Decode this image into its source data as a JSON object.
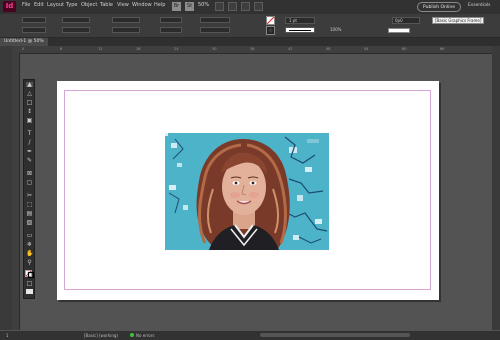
{
  "app": {
    "logo": "Id"
  },
  "menu": [
    "File",
    "Edit",
    "Layout",
    "Type",
    "Object",
    "Table",
    "View",
    "Window",
    "Help"
  ],
  "toolbar_icons": {
    "bridge": "Br",
    "stock": "St"
  },
  "zoom": "50%",
  "publish_label": "Publish Online",
  "workspace_label": "Essentials",
  "control": {
    "stroke_weight": "1 pt",
    "opacity": "100%",
    "frame_style": "[Basic Graphics Frame]",
    "ref_value": "0p0"
  },
  "document_tab": "Untitled-1 @ 50%",
  "ruler_marks": [
    "0",
    "6",
    "12",
    "18",
    "24",
    "30",
    "36",
    "42",
    "48",
    "54",
    "60",
    "66"
  ],
  "status": {
    "pages": "1",
    "profile": "[Basic] (working)",
    "errors": "No errors"
  },
  "tools": [
    "selection-tool",
    "direct-selection-tool",
    "page-tool",
    "gap-tool",
    "content-collector-tool",
    "type-tool",
    "line-tool",
    "pen-tool",
    "pencil-tool",
    "rectangle-frame-tool",
    "rectangle-tool",
    "scissors-tool",
    "free-transform-tool",
    "gradient-swatch-tool",
    "gradient-feather-tool",
    "note-tool",
    "eyedropper-tool",
    "hand-tool",
    "zoom-tool",
    "fill-stroke",
    "formatting-toggle",
    "view-mode",
    "screen-mode"
  ],
  "colors": {
    "artwork_bg": "#4db3c9",
    "page": "#ffffff",
    "pasteboard": "#535353"
  }
}
